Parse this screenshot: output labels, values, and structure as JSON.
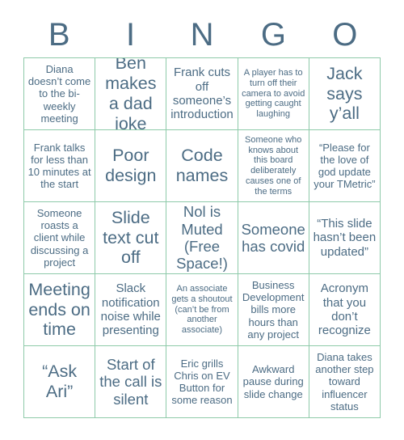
{
  "card": {
    "header_letters": [
      "B",
      "I",
      "N",
      "G",
      "O"
    ],
    "text_color": "#4c6c84",
    "grid_line_color": "#8ecaa9",
    "background_color": "#ffffff",
    "rows": [
      [
        {
          "text": "Diana doesn’t come to the bi-weekly meeting",
          "size": "fs-sm"
        },
        {
          "text": "Ben makes a dad joke",
          "size": "fs-xl"
        },
        {
          "text": "Frank cuts off someone’s introduction",
          "size": "fs-md"
        },
        {
          "text": "A player has to turn off their camera to avoid getting caught laughing",
          "size": "fs-xs"
        },
        {
          "text": "Jack says y’all",
          "size": "fs-xl"
        }
      ],
      [
        {
          "text": "Frank talks for less than 10 minutes at the start",
          "size": "fs-sm"
        },
        {
          "text": "Poor design",
          "size": "fs-xl"
        },
        {
          "text": "Code names",
          "size": "fs-xl"
        },
        {
          "text": "Someone who knows about this board deliberately causes one of the terms",
          "size": "fs-xs"
        },
        {
          "text": "“Please for the love of god update your TMetric”",
          "size": "fs-sm"
        }
      ],
      [
        {
          "text": "Someone roasts a client while discussing a project",
          "size": "fs-sm"
        },
        {
          "text": "Slide text cut off",
          "size": "fs-xl"
        },
        {
          "text": "Nol is Muted (Free Space!)",
          "size": "fs-lg"
        },
        {
          "text": "Someone has covid",
          "size": "fs-lg"
        },
        {
          "text": "“This slide hasn’t been updated”",
          "size": "fs-md"
        }
      ],
      [
        {
          "text": "Meeting ends on time",
          "size": "fs-xl"
        },
        {
          "text": "Slack notification noise while presenting",
          "size": "fs-md"
        },
        {
          "text": "An associate gets a shoutout (can’t be from another associate)",
          "size": "fs-xs"
        },
        {
          "text": "Business Development bills more hours than any project",
          "size": "fs-sm"
        },
        {
          "text": "Acronym that you don’t recognize",
          "size": "fs-md"
        }
      ],
      [
        {
          "text": "“Ask Ari”",
          "size": "fs-xl"
        },
        {
          "text": "Start of the call is silent",
          "size": "fs-lg"
        },
        {
          "text": "Eric grills Chris on EV Button for some reason",
          "size": "fs-sm"
        },
        {
          "text": "Awkward pause during slide change",
          "size": "fs-sm"
        },
        {
          "text": "Diana takes another step toward influencer status",
          "size": "fs-sm"
        }
      ]
    ]
  }
}
